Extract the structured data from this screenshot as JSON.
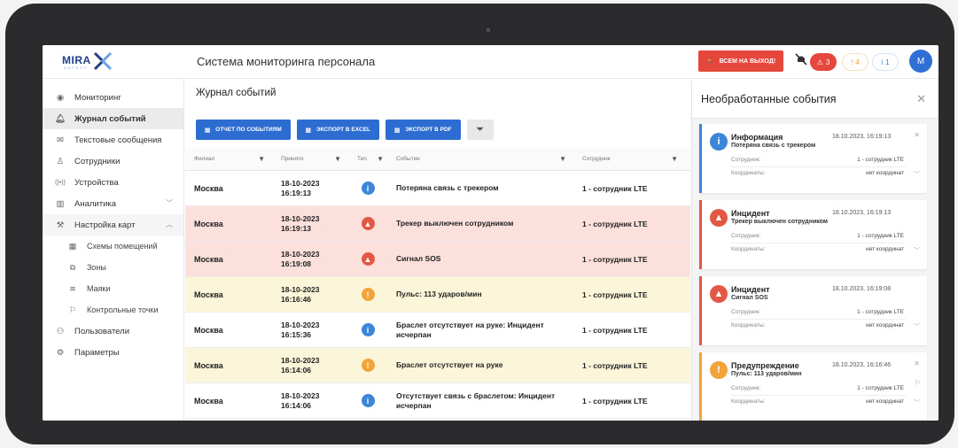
{
  "app": {
    "logo_text": "MIRA",
    "logo_sub": "SAFETY",
    "title": "Система мониторинга персонала",
    "exit_button": "ВСЕМ НА ВЫХОД!",
    "counter_critical": "3",
    "counter_warning": "4",
    "counter_info": "1",
    "avatar_letter": "M"
  },
  "sidebar": {
    "items": [
      {
        "label": "Мониторинг",
        "icon": "eye-icon"
      },
      {
        "label": "Журнал событий",
        "icon": "bell-icon"
      },
      {
        "label": "Текстовые сообщения",
        "icon": "mail-icon"
      },
      {
        "label": "Сотрудники",
        "icon": "person-icon"
      },
      {
        "label": "Устройства",
        "icon": "signal-icon"
      },
      {
        "label": "Аналитика",
        "icon": "chart-icon"
      },
      {
        "label": "Настройка карт",
        "icon": "wrench-icon"
      },
      {
        "label": "Схемы помещений",
        "icon": "floorplan-icon"
      },
      {
        "label": "Зоны",
        "icon": "zones-icon"
      },
      {
        "label": "Маяки",
        "icon": "beacon-icon"
      },
      {
        "label": "Контрольные точки",
        "icon": "flag-icon"
      },
      {
        "label": "Пользователи",
        "icon": "users-icon"
      },
      {
        "label": "Параметры",
        "icon": "gear-icon"
      }
    ]
  },
  "main": {
    "title": "Журнал событий",
    "buttons": {
      "report": "ОТЧЕТ ПО СОБЫТИЯМ",
      "excel": "ЭКСПОРТ В EXCEL",
      "pdf": "ЭКСПОРТ В PDF"
    },
    "columns": [
      "Филиал",
      "Принято",
      "Тип",
      "Событие",
      "Сотрудник"
    ],
    "rows": [
      {
        "branch": "Москва",
        "date": "18-10-2023",
        "time": "16:19:13",
        "type": "info",
        "event": "Потеряна связь с трекером",
        "employee": "1 - сотрудник LTE"
      },
      {
        "branch": "Москва",
        "date": "18-10-2023",
        "time": "16:19:13",
        "type": "crit",
        "event": "Трекер выключен сотрудником",
        "employee": "1 - сотрудник LTE"
      },
      {
        "branch": "Москва",
        "date": "18-10-2023",
        "time": "16:19:08",
        "type": "crit",
        "event": "Сигнал SOS",
        "employee": "1 - сотрудник LTE"
      },
      {
        "branch": "Москва",
        "date": "18-10-2023",
        "time": "16:16:46",
        "type": "warn",
        "event": "Пульс: 113 ударов/мин",
        "employee": "1 - сотрудник LTE"
      },
      {
        "branch": "Москва",
        "date": "18-10-2023",
        "time": "16:15:36",
        "type": "info",
        "event": "Браслет отсутствует на руке: Инцидент исчерпан",
        "employee": "1 - сотрудник LTE"
      },
      {
        "branch": "Москва",
        "date": "18-10-2023",
        "time": "16:14:06",
        "type": "warn",
        "event": "Браслет отсутствует на руке",
        "employee": "1 - сотрудник LTE"
      },
      {
        "branch": "Москва",
        "date": "18-10-2023",
        "time": "16:14:06",
        "type": "info",
        "event": "Отсутствует связь с браслетом: Инцидент исчерпан",
        "employee": "1 - сотрудник LTE"
      }
    ]
  },
  "panel": {
    "title": "Необработанные события",
    "employee_label": "Сотрудник:",
    "coords_label": "Координаты:",
    "cards": [
      {
        "kind": "info",
        "title": "Информация",
        "time": "18.10.2023, 16:19:13",
        "desc": "Потеряна связь с трекером",
        "employee": "1 - сотрудник LTE",
        "coords": "нет координат"
      },
      {
        "kind": "crit",
        "title": "Инцидент",
        "time": "18.10.2023, 16:19:13",
        "desc": "Трекер выключен сотрудником",
        "employee": "1 - сотрудник LTE",
        "coords": "нет координат"
      },
      {
        "kind": "crit",
        "title": "Инцидент",
        "time": "18.10.2023, 16:19:08",
        "desc": "Сигнал SOS",
        "employee": "1 - сотрудник LTE",
        "coords": "нет координат"
      },
      {
        "kind": "warn",
        "title": "Предупреждение",
        "time": "18.10.2023, 16:16:46",
        "desc": "Пульс: 113 ударов/мин",
        "employee": "1 - сотрудник LTE",
        "coords": "нет координат"
      }
    ]
  },
  "colors": {
    "accent": "#2d6cd0",
    "critical": "#e25845",
    "warning": "#f2a33a",
    "info": "#3b86d9",
    "critical_row": "#fbe0dc",
    "warning_row": "#fbf6d9"
  }
}
